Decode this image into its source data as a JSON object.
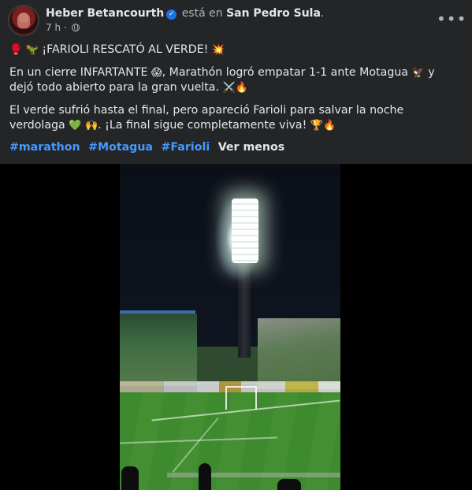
{
  "post": {
    "author": "Heber Betancourth",
    "is_in": "está en",
    "place": "San Pedro Sula",
    "period": ".",
    "time": "7 h",
    "separator": "·",
    "more": "•••"
  },
  "content": {
    "title_emoji_1": "🥊",
    "title_emoji_2": "🦖",
    "title": "¡FARIOLI RESCATÓ AL VERDE!",
    "title_emoji_3": "💥",
    "p1_a": "En un cierre INFARTANTE",
    "p1_emoji_1": "😱",
    "p1_b": ", Marathón logró empatar 1-1 ante Motagua",
    "p1_emoji_2": "🦅",
    "p1_c": " y dejó todo abierto para la gran vuelta.",
    "p1_emoji_3": "⚔️",
    "p1_emoji_4": "🔥",
    "p2_a": "El verde sufrió hasta el final, pero apareció Farioli para salvar la noche verdolaga",
    "p2_emoji_1": "💚",
    "p2_emoji_2": "🙌",
    "p2_b": ". ¡La final sigue completamente viva!",
    "p2_emoji_3": "🏆",
    "p2_emoji_4": "🔥",
    "hashtags": [
      "#marathon",
      "#Motagua",
      "#Farioli"
    ],
    "see_less": "Ver menos"
  },
  "icons": {
    "verified": "verified-badge-icon",
    "privacy": "globe-icon",
    "more": "more-options-icon"
  },
  "colors": {
    "background": "#242526",
    "text": "#e4e6eb",
    "secondary_text": "#b0b3b8",
    "hashtag": "#4599ff",
    "verified": "#1b74e4"
  }
}
